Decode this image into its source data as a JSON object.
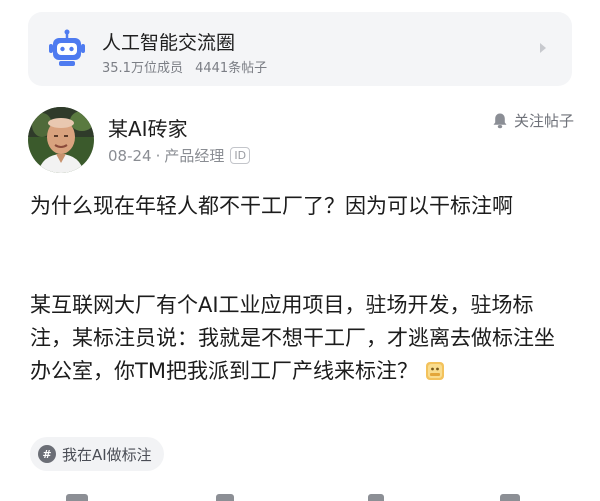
{
  "group": {
    "name": "人工智能交流圈",
    "members": "35.1万位成员",
    "posts": "4441条帖子",
    "icon": "robot-icon",
    "accent": "#4e7bf0"
  },
  "author": {
    "name": "某AI砖家",
    "date": "08-24",
    "role": "产品经理",
    "badge": "ID"
  },
  "follow": {
    "label": "关注帖子",
    "icon": "bell-icon"
  },
  "post": {
    "title": "为什么现在年轻人都不干工厂了？因为可以干标注啊",
    "body": "某互联网大厂有个AI工业应用项目，驻场开发，驻场标注，某标注员说：我就是不想干工厂，才逃离去做标注坐办公室，你TM把我派到工厂产线来标注？"
  },
  "topic": {
    "label": "我在AI做标注",
    "icon": "hashtag-icon"
  }
}
